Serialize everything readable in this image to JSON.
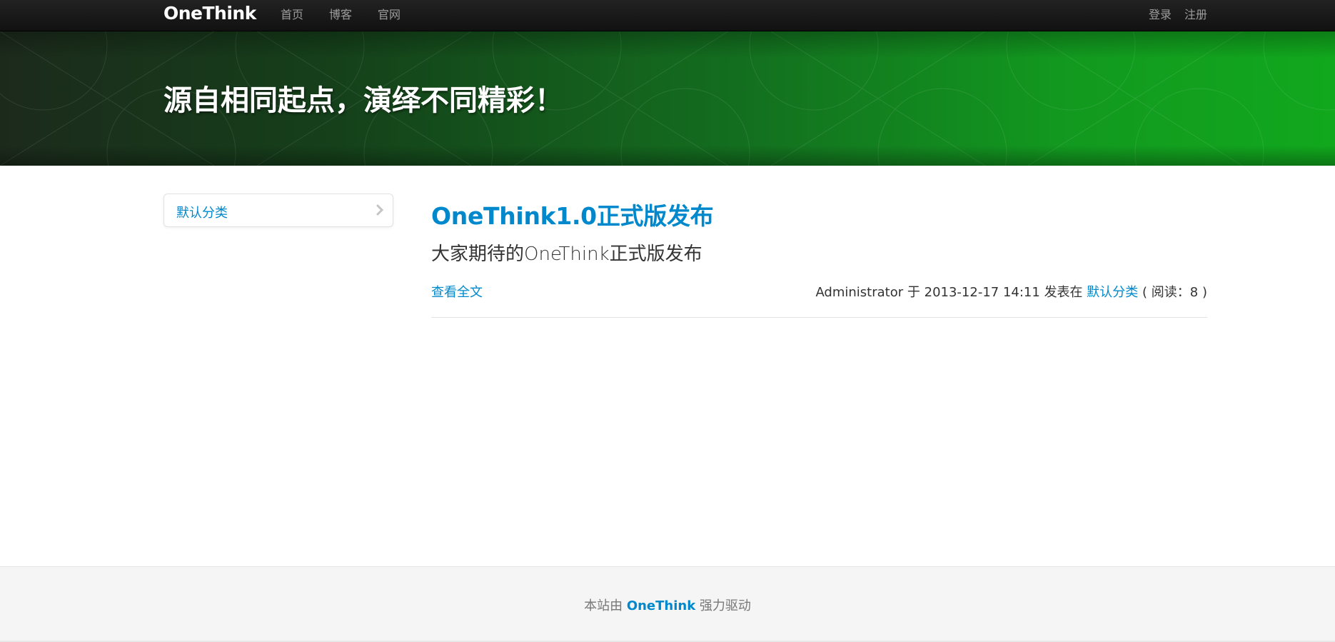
{
  "navbar": {
    "brand": "OneThink",
    "links": [
      "首页",
      "博客",
      "官网"
    ],
    "login": "登录",
    "register": "注册"
  },
  "hero": {
    "title": "源自相同起点，演绎不同精彩！"
  },
  "sidebar": {
    "items": [
      {
        "label": "默认分类",
        "icon": "chevron-right-icon"
      }
    ]
  },
  "article": {
    "title": "OneThink1.0正式版发布",
    "summary": "大家期待的OneThink正式版发布",
    "read_more": "查看全文",
    "author": "Administrator",
    "at_word": "于",
    "date": "2013-12-17 14:11",
    "posted_in": "发表在",
    "category": "默认分类",
    "views_prefix": "( 阅读：",
    "views": "8",
    "views_suffix": ")"
  },
  "footer": {
    "prefix": "本站由",
    "brand": "OneThink",
    "suffix": "强力驱动"
  },
  "colors": {
    "link": "#0088cc",
    "navbar": "#1a1a1a",
    "hero_green": "#11a81d"
  }
}
